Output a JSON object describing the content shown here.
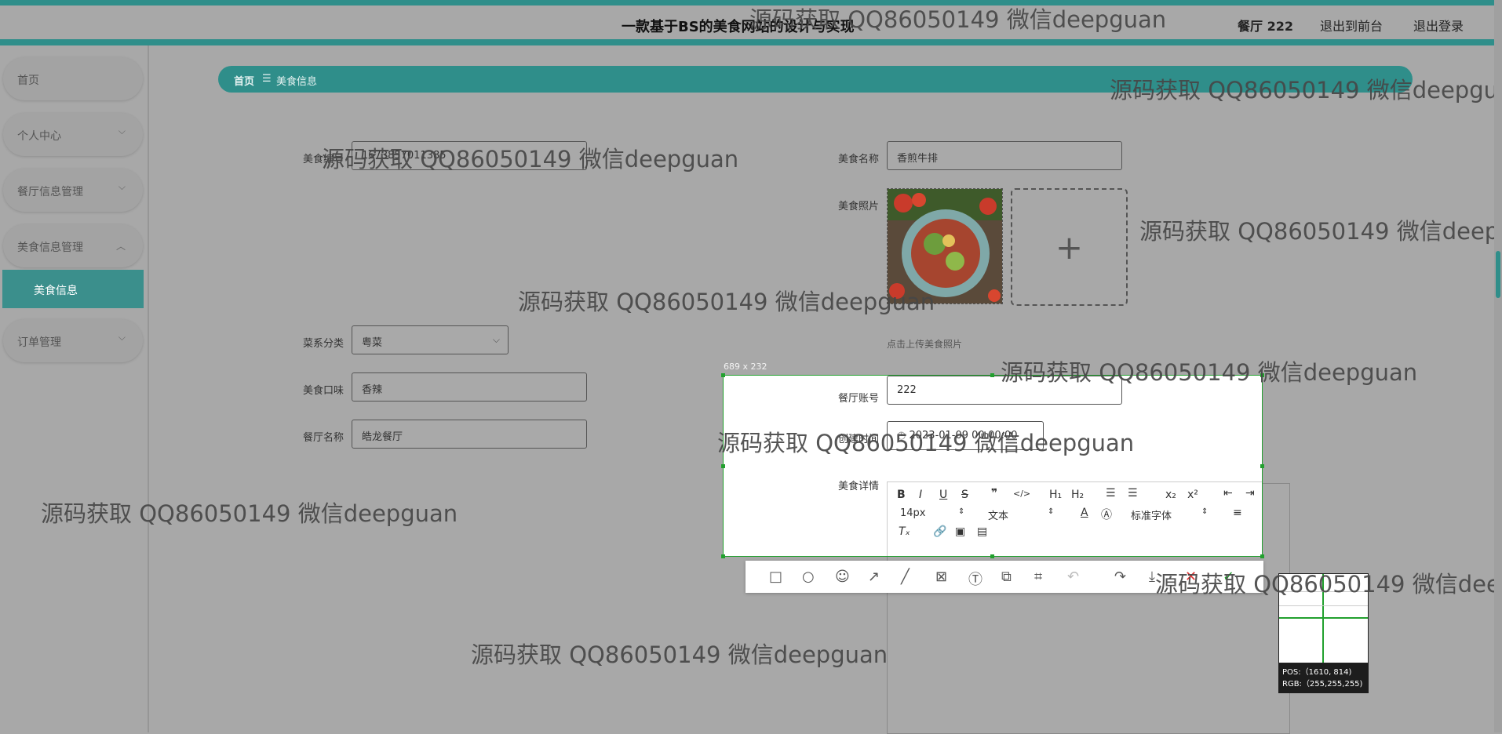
{
  "header": {
    "title": "一款基于BS的美食网站的设计与实现",
    "user": "餐厅 222",
    "front_link": "退出到前台",
    "logout_link": "退出登录"
  },
  "sidebar": {
    "items": [
      {
        "label": "首页",
        "has_chevron": false
      },
      {
        "label": "个人中心",
        "has_chevron": true
      },
      {
        "label": "餐厅信息管理",
        "has_chevron": true
      },
      {
        "label": "美食信息管理",
        "has_chevron": true,
        "expanded": true
      },
      {
        "label": "订单管理",
        "has_chevron": true
      }
    ],
    "sub_item": "美食信息"
  },
  "breadcrumb": {
    "home": "首页",
    "separator": "☰",
    "current": "美食信息"
  },
  "form": {
    "code_label": "美食编号",
    "code_value": "1673857011385",
    "name_label": "美食名称",
    "name_value": "香煎牛排",
    "photo_label": "美食照片",
    "upload_hint": "点击上传美食照片",
    "category_label": "菜系分类",
    "category_value": "粤菜",
    "taste_label": "美食口味",
    "taste_value": "香辣",
    "restaurant_label": "餐厅名称",
    "restaurant_value": "皓龙餐厅",
    "account_label": "餐厅账号",
    "account_value": "222",
    "time_label": "创建时间",
    "time_value": "2023-01-09 00:00:00",
    "detail_label": "美食详情"
  },
  "editor": {
    "font_size": "14px",
    "text_type": "文本",
    "font_family": "标准字体"
  },
  "capture": {
    "size_text": "689 x 232",
    "pos_text": "POS:（1610, 814)",
    "rgb_text": "RGB:（255,255,255)"
  },
  "watermark": "源码获取 QQ86050149 微信deepguan",
  "colors": {
    "accent": "#2f8e8a",
    "capture_green": "#22a02e"
  }
}
